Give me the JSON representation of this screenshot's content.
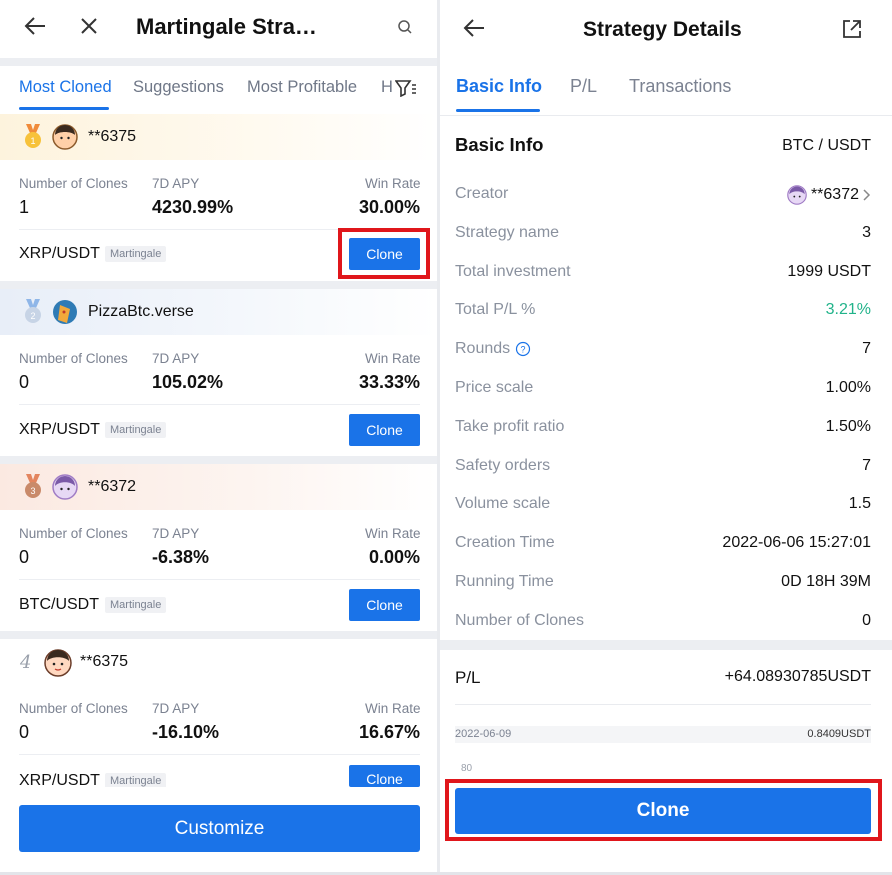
{
  "left": {
    "title": "Martingale Stra…",
    "tabs": [
      "Most Cloned",
      "Suggestions",
      "Most Profitable",
      "H"
    ],
    "labels": {
      "clones": "Number of Clones",
      "apy": "7D APY",
      "winrate": "Win Rate",
      "tag": "Martingale",
      "clone": "Clone"
    },
    "cards": [
      {
        "rank": "1",
        "name": "**6375",
        "clones": "1",
        "apy": "4230.99%",
        "winrate": "30.00%",
        "pair": "XRP/USDT"
      },
      {
        "rank": "2",
        "name": "PizzaBtc.verse",
        "clones": "0",
        "apy": "105.02%",
        "winrate": "33.33%",
        "pair": "XRP/USDT"
      },
      {
        "rank": "3",
        "name": "**6372",
        "clones": "0",
        "apy": "-6.38%",
        "winrate": "0.00%",
        "pair": "BTC/USDT"
      },
      {
        "rank": "4",
        "name": "**6375",
        "clones": "0",
        "apy": "-16.10%",
        "winrate": "16.67%",
        "pair": "XRP/USDT"
      }
    ],
    "customize": "Customize"
  },
  "right": {
    "title": "Strategy Details",
    "tabs": [
      "Basic Info",
      "P/L",
      "Transactions"
    ],
    "section_title": "Basic Info",
    "section_pair": "BTC / USDT",
    "rows": [
      {
        "k": "Creator",
        "v": "**6372"
      },
      {
        "k": "Strategy name",
        "v": "3"
      },
      {
        "k": "Total investment",
        "v": "1999 USDT"
      },
      {
        "k": "Total P/L %",
        "v": "3.21%"
      },
      {
        "k": "Rounds",
        "v": "7"
      },
      {
        "k": "Price scale",
        "v": "1.00%"
      },
      {
        "k": "Take profit ratio",
        "v": "1.50%"
      },
      {
        "k": "Safety orders",
        "v": "7"
      },
      {
        "k": "Volume scale",
        "v": "1.5"
      },
      {
        "k": "Creation Time",
        "v": "2022-06-06 15:27:01"
      },
      {
        "k": "Running Time",
        "v": "0D 18H 39M"
      },
      {
        "k": "Number of Clones",
        "v": "0"
      }
    ],
    "pl_label": "P/L",
    "pl_value": "+64.08930785USDT",
    "chart_date": "2022-06-09",
    "chart_value": "0.8409USDT",
    "chart_axis": "80",
    "clone": "Clone"
  },
  "colors": {
    "accent": "#1a73e8",
    "highlight": "#e0161b",
    "positive": "#21b38a"
  }
}
